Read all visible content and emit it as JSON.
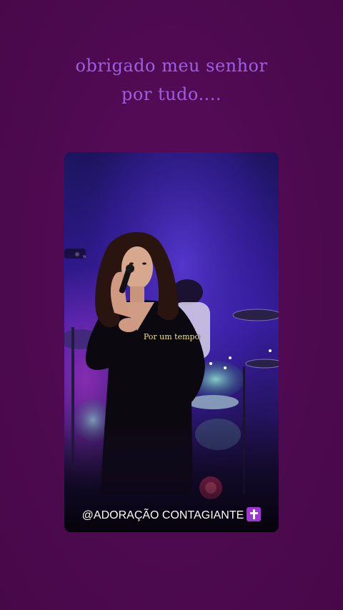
{
  "story": {
    "caption_line1": "obrigado meu senhor",
    "caption_line2": "por tudo....",
    "caption_color": "#9d5fe0",
    "background_color": "#4f0a50"
  },
  "video": {
    "lyric": "Por um tempo",
    "watermark": "@ADORAÇÃO CONTAGIANTE",
    "watermark_icon": "latin-cross-icon",
    "lyric_color": "#f2e86a"
  }
}
